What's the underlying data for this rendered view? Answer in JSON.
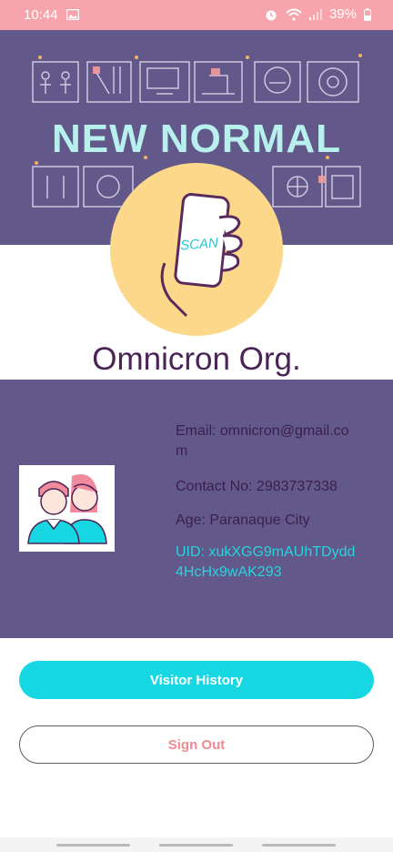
{
  "status_bar": {
    "time": "10:44",
    "battery": "39%",
    "icons": [
      "image-icon",
      "alarm-icon",
      "wifi-icon",
      "signal-icon",
      "battery-icon"
    ]
  },
  "banner": {
    "title": "NEW NORMAL"
  },
  "logo": {
    "text": "SCAN"
  },
  "org": {
    "name": "Omnicron Org."
  },
  "info": {
    "email": "Email: omnicron@gmail.com",
    "contact": "Contact No: 2983737338",
    "age": "Age: Paranaque City",
    "uid": "UID: xukXGG9mAUhTDydd4HcHx9wAK293"
  },
  "buttons": {
    "visitor_history": "Visitor History",
    "sign_out": "Sign Out"
  },
  "colors": {
    "status_bar": "#f8a4ad",
    "panel": "#62598a",
    "accent": "#17d8e2",
    "title_text": "#4a2456",
    "logo_bg": "#fbd88a"
  }
}
